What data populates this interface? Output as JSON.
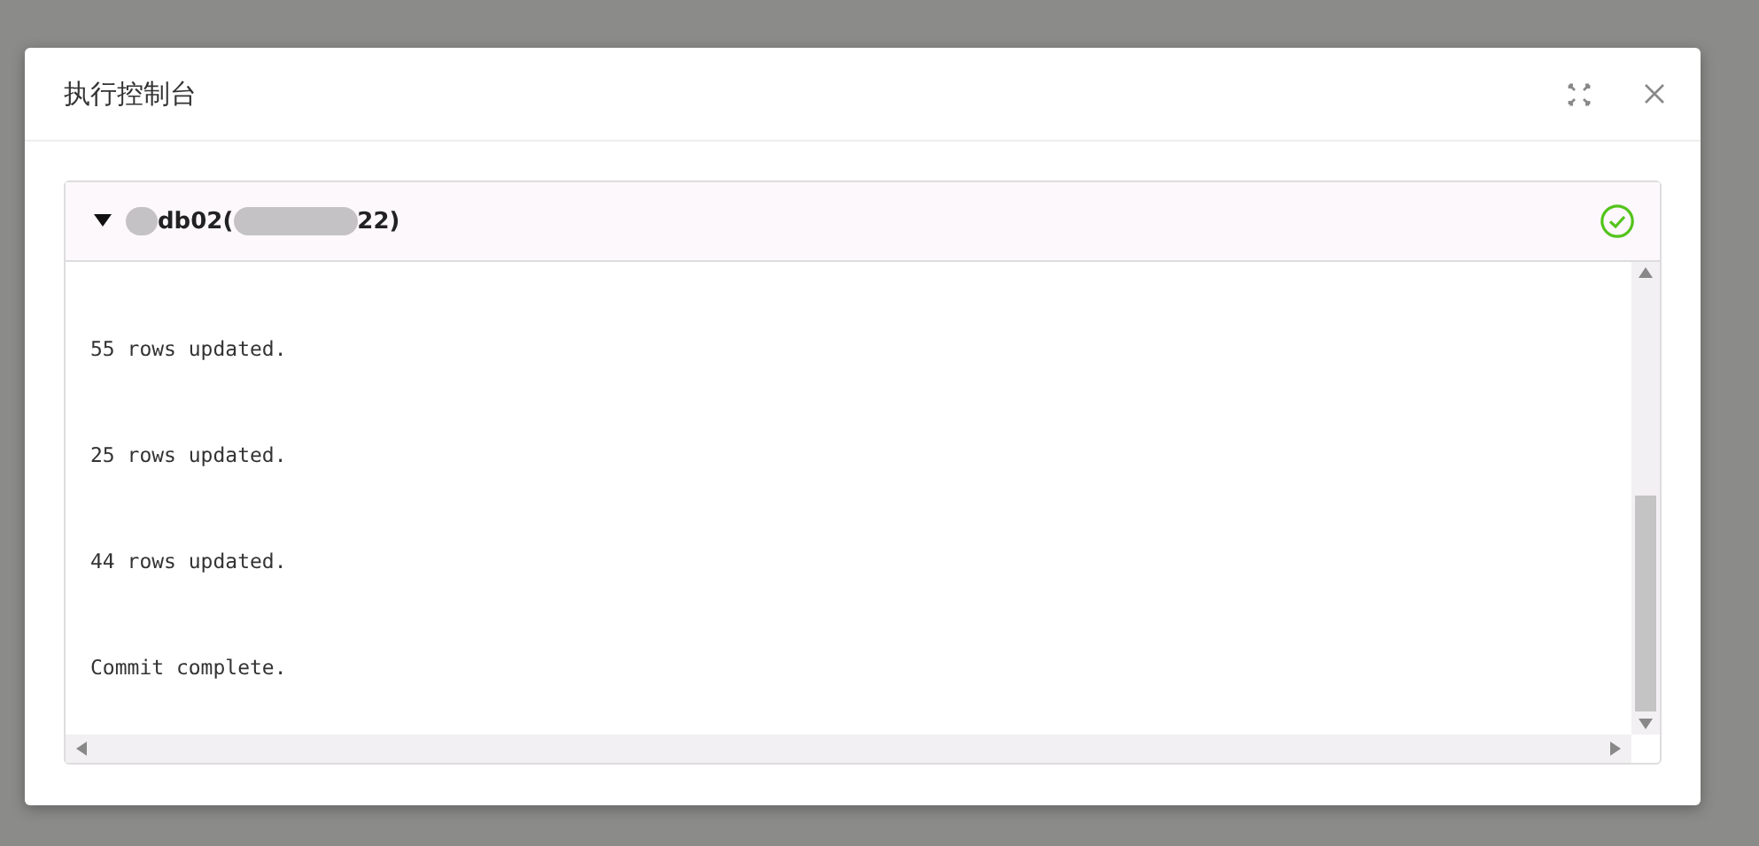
{
  "dialog": {
    "title": "执行控制台"
  },
  "panel": {
    "expanded": true,
    "host_prefix": "db02(",
    "host_suffix": "22)",
    "succeeded": true,
    "log_lines": [
      "55 rows updated.",
      "25 rows updated.",
      "44 rows updated.",
      "Commit complete."
    ]
  }
}
